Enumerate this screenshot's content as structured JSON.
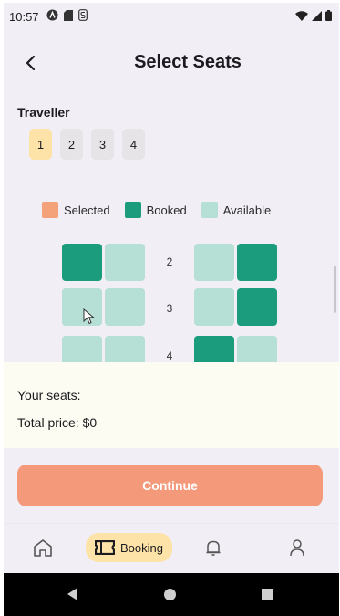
{
  "status_bar": {
    "time": "10:57",
    "icons": [
      "a-badge-icon",
      "sim-icon",
      "s-icon",
      "wifi-icon",
      "signal-icon",
      "battery-icon"
    ]
  },
  "header": {
    "back_icon": "chevron-left-icon",
    "title": "Select Seats"
  },
  "traveller": {
    "label": "Traveller",
    "options": [
      "1",
      "2",
      "3",
      "4"
    ],
    "selected": "1"
  },
  "legend": [
    {
      "label": "Selected",
      "color": "#f4a27a"
    },
    {
      "label": "Booked",
      "color": "#1a9c7d"
    },
    {
      "label": "Available",
      "color": "#b6e0d6"
    }
  ],
  "seats": {
    "rows": [
      {
        "number": "2",
        "seats": [
          "booked",
          "available",
          "available",
          "booked"
        ]
      },
      {
        "number": "3",
        "seats": [
          "available",
          "available",
          "available",
          "booked"
        ]
      },
      {
        "number": "4",
        "seats": [
          "available",
          "available",
          "booked",
          "available"
        ]
      }
    ]
  },
  "summary": {
    "seats_label": "Your seats:",
    "total_label": "Total price: $0"
  },
  "continue_label": "Continue",
  "bottom_nav": [
    {
      "id": "home",
      "icon": "home-icon",
      "label": ""
    },
    {
      "id": "booking",
      "icon": "ticket-icon",
      "label": "Booking",
      "active": true
    },
    {
      "id": "notifications",
      "icon": "bell-icon",
      "label": ""
    },
    {
      "id": "profile",
      "icon": "person-icon",
      "label": ""
    }
  ],
  "colors": {
    "selected": "#f4a27a",
    "booked": "#1a9c7d",
    "available": "#b6e0d6",
    "accent": "#f4997a",
    "chip_active": "#fde3a7"
  }
}
